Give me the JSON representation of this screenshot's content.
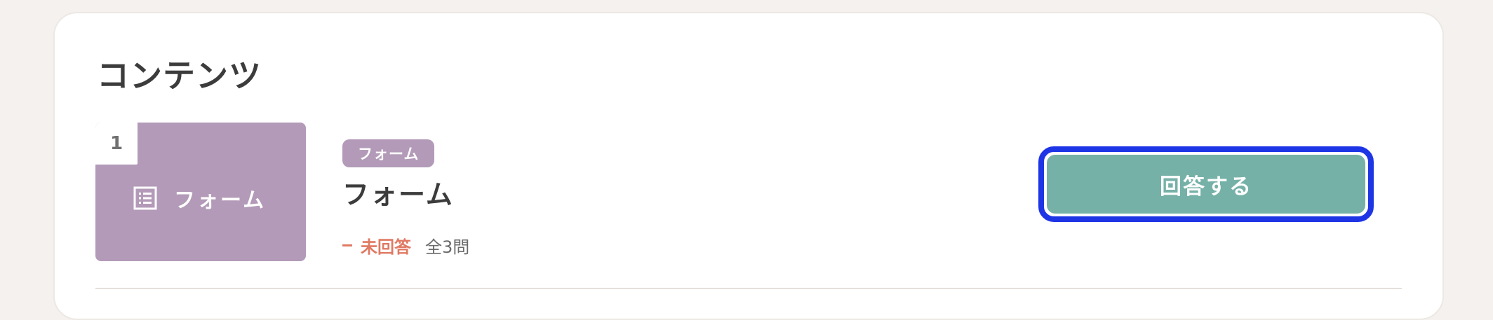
{
  "contents": {
    "section_title": "コンテンツ",
    "items": [
      {
        "number": "1",
        "thumbnail": {
          "icon": "list-form-icon",
          "label": "フォーム",
          "color": "#b39ab8"
        },
        "type_badge": "フォーム",
        "title": "フォーム",
        "status": "未回答",
        "status_color": "#e07a63",
        "question_count": "全3問",
        "action_button": {
          "label": "回答する",
          "color": "#76b1a8",
          "focus_ring_color": "#1e35e6"
        }
      }
    ]
  }
}
